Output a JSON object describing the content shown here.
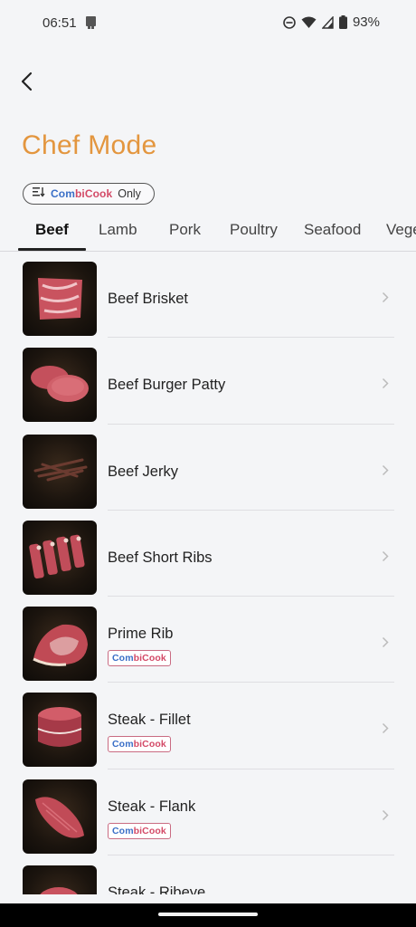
{
  "status_bar": {
    "time": "06:51",
    "battery": "93%"
  },
  "header": {
    "title": "Chef Mode"
  },
  "filter": {
    "brand_part1": "Com",
    "brand_part2": "biCook",
    "label": "Only"
  },
  "tabs": [
    {
      "label": "Beef",
      "active": true
    },
    {
      "label": "Lamb",
      "active": false
    },
    {
      "label": "Pork",
      "active": false
    },
    {
      "label": "Poultry",
      "active": false
    },
    {
      "label": "Seafood",
      "active": false
    },
    {
      "label": "Vege",
      "active": false
    }
  ],
  "items": [
    {
      "title": "Beef Brisket",
      "badge": false
    },
    {
      "title": "Beef Burger Patty",
      "badge": false
    },
    {
      "title": "Beef Jerky",
      "badge": false
    },
    {
      "title": "Beef Short Ribs",
      "badge": false
    },
    {
      "title": "Prime Rib",
      "badge": true
    },
    {
      "title": "Steak - Fillet",
      "badge": true
    },
    {
      "title": "Steak - Flank",
      "badge": true
    },
    {
      "title": "Steak - Ribeye",
      "badge": false
    }
  ],
  "badge": {
    "brand_part1": "Com",
    "brand_part2": "biCook"
  },
  "colors": {
    "accent": "#e3963f",
    "brand_blue": "#3a6fc7",
    "brand_red": "#d34a67",
    "background": "#f4f5f7"
  }
}
